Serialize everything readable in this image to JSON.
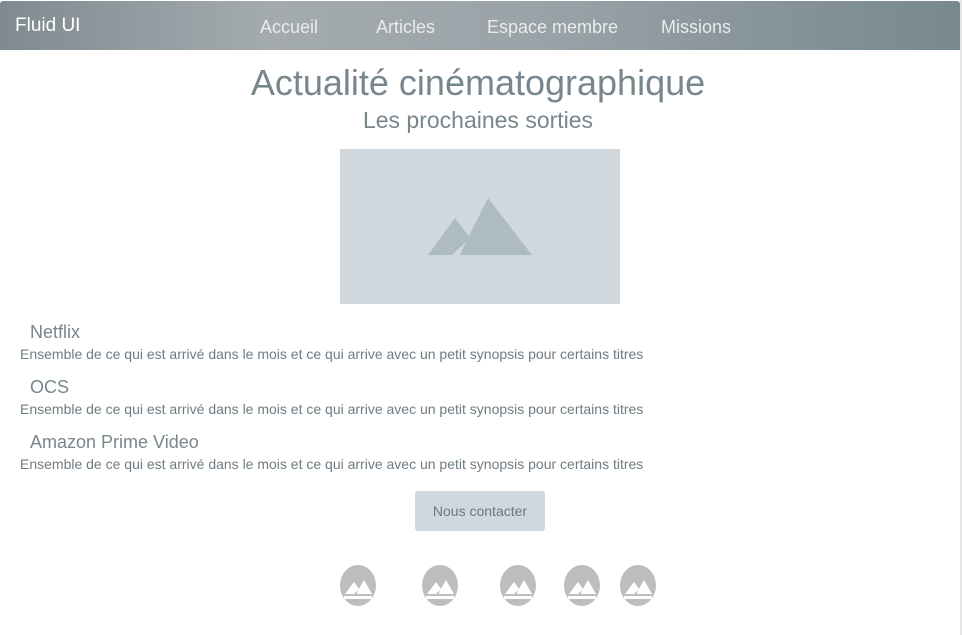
{
  "app": {
    "brand": "Fluid UI"
  },
  "nav": {
    "items": [
      {
        "label": "Accueil"
      },
      {
        "label": "Articles"
      },
      {
        "label": "Espace membre"
      },
      {
        "label": "Missions"
      }
    ]
  },
  "main": {
    "title": "Actualité cinématographique",
    "subtitle": "Les prochaines sorties",
    "hero_image": {
      "icon": "image-placeholder-icon"
    },
    "sections": [
      {
        "title": "Netflix",
        "text": "Ensemble de ce qui est arrivé dans le mois et ce qui arrive avec un petit synopsis pour certains titres"
      },
      {
        "title": "OCS",
        "text": "Ensemble de ce qui est arrivé dans le mois et ce qui arrive avec un petit synopsis pour certains titres"
      },
      {
        "title": "Amazon Prime Video",
        "text": "Ensemble de ce qui est arrivé dans le mois et ce qui arrive avec un petit synopsis pour certains titres"
      }
    ],
    "contact_label": "Nous contacter"
  },
  "footer": {
    "icons": [
      {
        "icon": "image-placeholder-icon"
      },
      {
        "icon": "image-placeholder-icon"
      },
      {
        "icon": "image-placeholder-icon"
      },
      {
        "icon": "image-placeholder-icon"
      },
      {
        "icon": "image-placeholder-icon"
      }
    ]
  },
  "colors": {
    "navbar_start": "#7f8a90",
    "navbar_end": "#78888f",
    "text_primary": "#78868d",
    "placeholder_bg": "#d0d8de",
    "placeholder_icon": "#aebcc1",
    "button_bg": "#cfd8de",
    "footer_icon_bg": "#bdbdbd"
  }
}
